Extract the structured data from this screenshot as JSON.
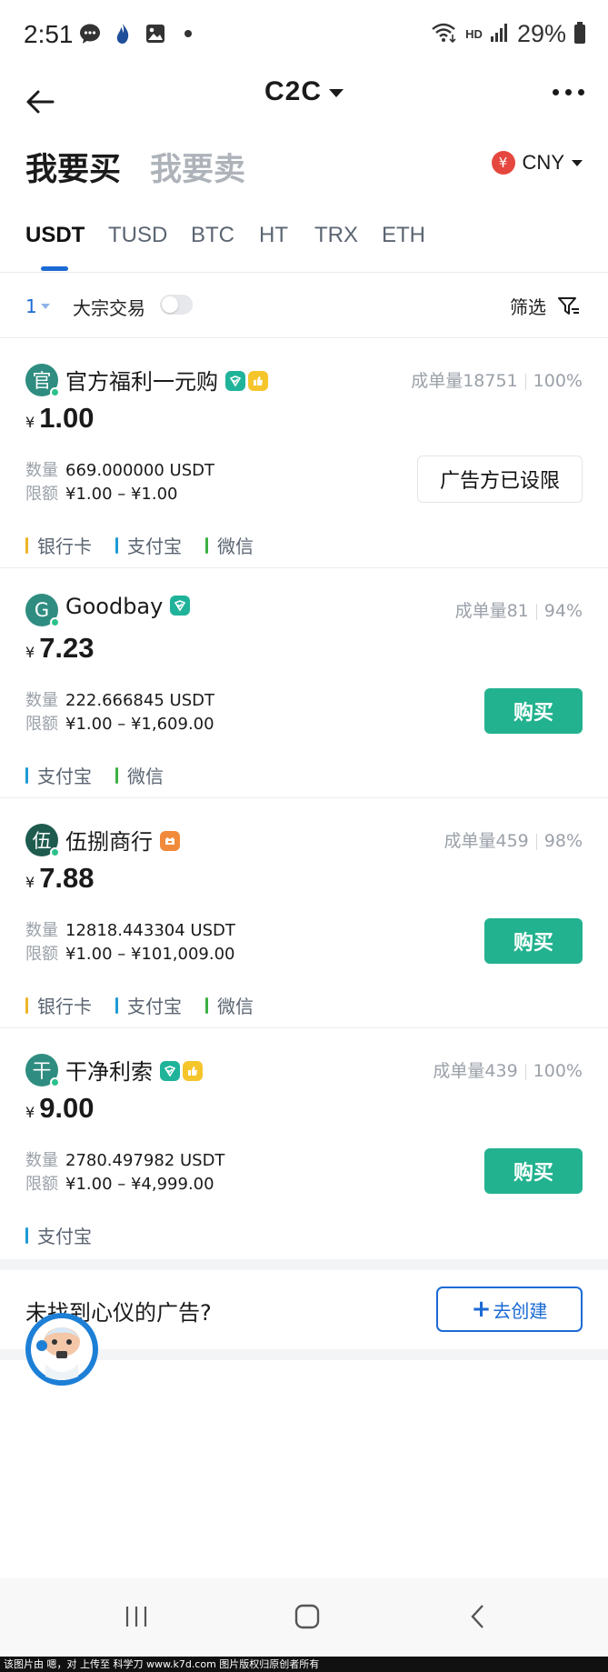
{
  "status_bar": {
    "time": "2:51",
    "network": "HD",
    "battery": "29%",
    "icons": [
      "chat-bubble-icon",
      "app-flame-icon",
      "gallery-icon",
      "dot-icon",
      "wifi-icon",
      "signal-icon",
      "battery-icon"
    ]
  },
  "header": {
    "title": "C2C",
    "back_icon": "arrow-left-icon",
    "more_icon": "more-dots-icon"
  },
  "trade_tabs": {
    "buy": "我要买",
    "sell": "我要卖",
    "active": "buy",
    "currency": "CNY",
    "currency_symbol": "¥"
  },
  "coin_tabs": {
    "items": [
      "USDT",
      "TUSD",
      "BTC",
      "HT",
      "TRX",
      "ETH"
    ],
    "active": "USDT"
  },
  "filter_row": {
    "page": "1",
    "bulk_label": "大宗交易",
    "bulk_enabled": false,
    "filter_label": "筛选"
  },
  "ads": [
    {
      "avatar": "官",
      "name": "官方福利一元购",
      "badges": [
        "verified",
        "thumb"
      ],
      "orders_label": "成单量18751",
      "rate": "100%",
      "currency_symbol": "¥",
      "price": "1.00",
      "qty_label": "数量",
      "qty": "669.000000 USDT",
      "limit_label": "限额",
      "limit": "¥1.00 – ¥1.00",
      "action": "广告方已设限",
      "action_type": "limited",
      "payments": [
        {
          "label": "银行卡",
          "color": "#f0b429"
        },
        {
          "label": "支付宝",
          "color": "#1e9ad6"
        },
        {
          "label": "微信",
          "color": "#3cb043"
        }
      ]
    },
    {
      "avatar": "G",
      "name": "Goodbay",
      "badges": [
        "verified"
      ],
      "orders_label": "成单量81",
      "rate": "94%",
      "currency_symbol": "¥",
      "price": "7.23",
      "qty_label": "数量",
      "qty": "222.666845 USDT",
      "limit_label": "限额",
      "limit": "¥1.00 – ¥1,609.00",
      "action": "购买",
      "action_type": "buy",
      "payments": [
        {
          "label": "支付宝",
          "color": "#1e9ad6"
        },
        {
          "label": "微信",
          "color": "#3cb043"
        }
      ]
    },
    {
      "avatar": "伍",
      "name": "伍捌商行",
      "badges": [
        "merchant"
      ],
      "orders_label": "成单量459",
      "rate": "98%",
      "currency_symbol": "¥",
      "price": "7.88",
      "qty_label": "数量",
      "qty": "12818.443304 USDT",
      "limit_label": "限额",
      "limit": "¥1.00 – ¥101,009.00",
      "action": "购买",
      "action_type": "buy",
      "payments": [
        {
          "label": "银行卡",
          "color": "#f0b429"
        },
        {
          "label": "支付宝",
          "color": "#1e9ad6"
        },
        {
          "label": "微信",
          "color": "#3cb043"
        }
      ]
    },
    {
      "avatar": "干",
      "name": "干净利索",
      "badges": [
        "verified",
        "thumb"
      ],
      "orders_label": "成单量439",
      "rate": "100%",
      "currency_symbol": "¥",
      "price": "9.00",
      "qty_label": "数量",
      "qty": "2780.497982 USDT",
      "limit_label": "限额",
      "limit": "¥1.00 – ¥4,999.00",
      "action": "购买",
      "action_type": "buy",
      "payments": [
        {
          "label": "支付宝",
          "color": "#1e9ad6"
        }
      ]
    }
  ],
  "not_found": {
    "text": "未找到心仪的广告?",
    "create_plus": "+",
    "create_label": "去创建"
  },
  "nav": [
    "recent-apps-icon",
    "home-icon",
    "back-icon"
  ],
  "footer": "该图片由 嗯，对 上传至 科学刀 www.k7d.com 图片版权归原创者所有",
  "colors": {
    "accent": "#1b6ad4",
    "buy": "#22b28f",
    "muted": "#9ba1a9",
    "cny_badge": "#e5473e"
  }
}
